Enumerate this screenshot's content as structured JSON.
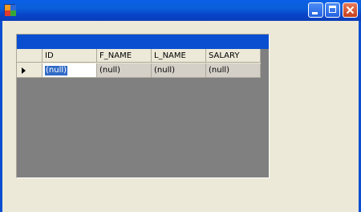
{
  "window": {
    "title": ""
  },
  "grid": {
    "columns": [
      "ID",
      "F_NAME",
      "L_NAME",
      "SALARY"
    ],
    "rows": [
      {
        "ID": "(null)",
        "F_NAME": "(null)",
        "L_NAME": "(null)",
        "SALARY": "(null)"
      }
    ],
    "editing_cell": "ID"
  },
  "colors": {
    "titlebar": "#0a5fe8",
    "caption": "#0a4fd0",
    "selection": "#316ac5",
    "background": "#808080",
    "window_bg": "#ece9d8"
  }
}
